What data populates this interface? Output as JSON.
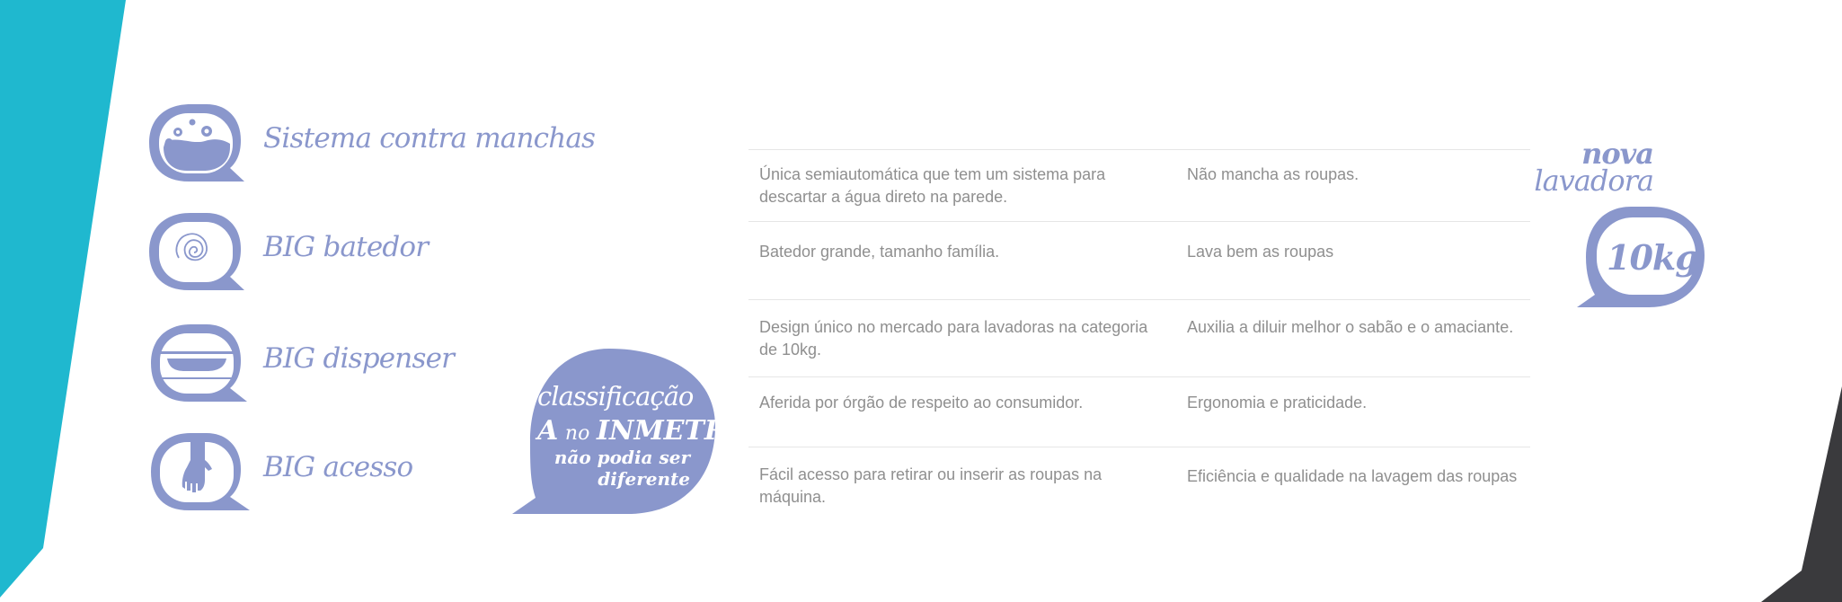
{
  "colors": {
    "accent": "#8a97cc",
    "teal": "#1fb8cf",
    "dark": "#3a3a3d",
    "text": "#8f8f8f"
  },
  "features": [
    {
      "label": "Sistema contra manchas",
      "icon": "bubbles-icon"
    },
    {
      "label": "BIG batedor",
      "icon": "spiral-icon"
    },
    {
      "label": "BIG dispenser",
      "icon": "dispenser-icon"
    },
    {
      "label": "BIG acesso",
      "icon": "hand-icon"
    }
  ],
  "inmetro": {
    "line1": "classificação",
    "line2_a": "A",
    "line2_no": "no",
    "line2_inmetro": "INMETRO",
    "line3": "não podia ser",
    "line4": "diferente"
  },
  "table": {
    "rows": [
      {
        "feature": "Única semiautomática que tem um sistema para descartar a água direto na parede.",
        "benefit": "Não mancha as roupas."
      },
      {
        "feature": "Batedor grande, tamanho família.",
        "benefit": "Lava bem as roupas"
      },
      {
        "feature": "Design único no mercado para lavadoras na categoria de 10kg.",
        "benefit": "Auxilia a diluir melhor o sabão e o amaciante."
      },
      {
        "feature": "Aferida por órgão de respeito ao consumidor.",
        "benefit": "Ergonomia e praticidade."
      },
      {
        "feature": "Fácil acesso para retirar ou inserir as roupas na máquina.",
        "benefit": "Eficiência e qualidade na lavagem das roupas"
      }
    ]
  },
  "nova": {
    "line1": "nova",
    "line2": "lavadora",
    "capacity": "10kg"
  }
}
